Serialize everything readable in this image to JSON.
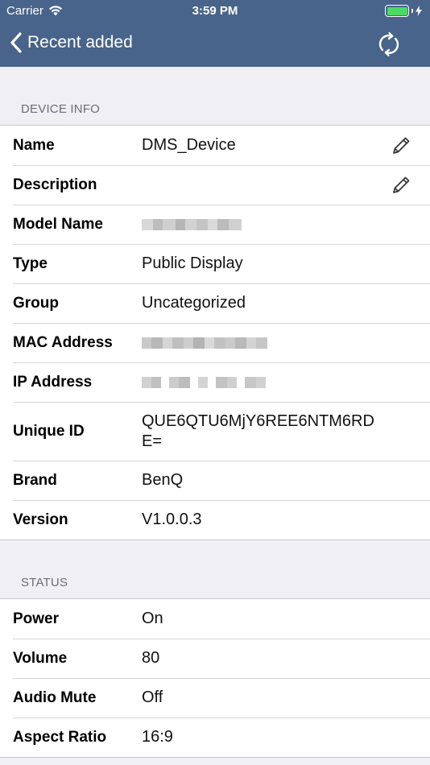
{
  "status_bar": {
    "carrier": "Carrier",
    "time": "3:59 PM",
    "battery_color": "#4cd964"
  },
  "nav": {
    "back_label": "Recent added",
    "back_icon": "chevron-left-icon",
    "refresh_icon": "refresh-icon",
    "bar_color": "#48648a"
  },
  "device_info": {
    "header": "DEVICE INFO",
    "rows": [
      {
        "label": "Name",
        "value": "DMS_Device",
        "editable": true
      },
      {
        "label": "Description",
        "value": "",
        "editable": true
      },
      {
        "label": "Model Name",
        "value": "",
        "redacted": true
      },
      {
        "label": "Type",
        "value": "Public Display"
      },
      {
        "label": "Group",
        "value": "Uncategorized"
      },
      {
        "label": "MAC Address",
        "value": "",
        "redacted": true
      },
      {
        "label": "IP Address",
        "value": "",
        "redacted": true
      },
      {
        "label": "Unique ID",
        "value": "QUE6QTU6MjY6REE6NTM6RDE="
      },
      {
        "label": "Brand",
        "value": "BenQ"
      },
      {
        "label": "Version",
        "value": "V1.0.0.3"
      }
    ]
  },
  "status": {
    "header": "STATUS",
    "rows": [
      {
        "label": "Power",
        "value": "On"
      },
      {
        "label": "Volume",
        "value": "80"
      },
      {
        "label": "Audio Mute",
        "value": "Off"
      },
      {
        "label": "Aspect Ratio",
        "value": "16:9"
      }
    ]
  }
}
